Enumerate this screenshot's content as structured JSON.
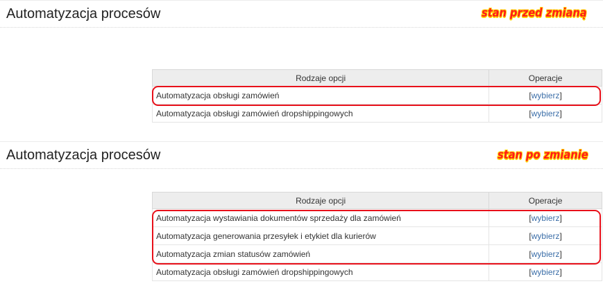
{
  "before": {
    "title": "Automatyzacja procesów",
    "annotation": "stan przed zmianą",
    "table": {
      "headers": [
        "Rodzaje opcji",
        "Operacje"
      ],
      "rows": [
        {
          "name": "Automatyzacja obsługi zamówień",
          "action": "wybierz"
        },
        {
          "name": "Automatyzacja obsługi zamówień dropshippingowych",
          "action": "wybierz"
        }
      ]
    }
  },
  "after": {
    "title": "Automatyzacja procesów",
    "annotation": "stan po zmianie",
    "table": {
      "headers": [
        "Rodzaje opcji",
        "Operacje"
      ],
      "rows": [
        {
          "name": "Automatyzacja wystawiania dokumentów sprzedaży dla zamówień",
          "action": "wybierz"
        },
        {
          "name": "Automatyzacja generowania przesyłek i etykiet dla kurierów",
          "action": "wybierz"
        },
        {
          "name": "Automatyzacja zmian statusów zamówień",
          "action": "wybierz"
        },
        {
          "name": "Automatyzacja obsługi zamówień dropshippingowych",
          "action": "wybierz"
        }
      ]
    }
  },
  "colors": {
    "annotation": "#ff1a1a",
    "annotation_outline": "#ffd400",
    "highlight": "#e8101a",
    "link": "#3b6ea8",
    "table_header_bg": "#ededed"
  }
}
